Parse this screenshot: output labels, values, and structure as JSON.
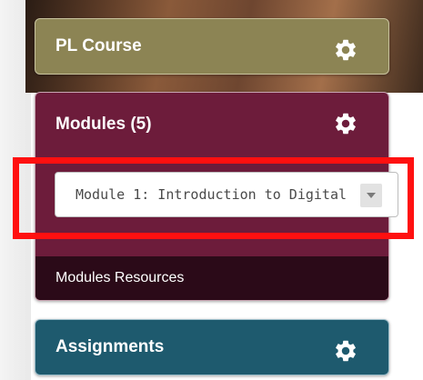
{
  "panels": {
    "pl_course": {
      "title": "PL Course",
      "color": "#8c8454"
    },
    "modules": {
      "title": "Modules  (5)",
      "color": "#6d1c3b",
      "select": {
        "selected_value": "Module 1: Introduction to Digital"
      },
      "resources_label": "Modules Resources",
      "resources_color": "#2b0a18"
    },
    "assignments": {
      "title": "Assignments",
      "color": "#1e5a6e"
    }
  },
  "icons": {
    "settings": "gear-icon",
    "dropdown": "chevron-down-icon"
  },
  "highlight_color": "#ff1010"
}
